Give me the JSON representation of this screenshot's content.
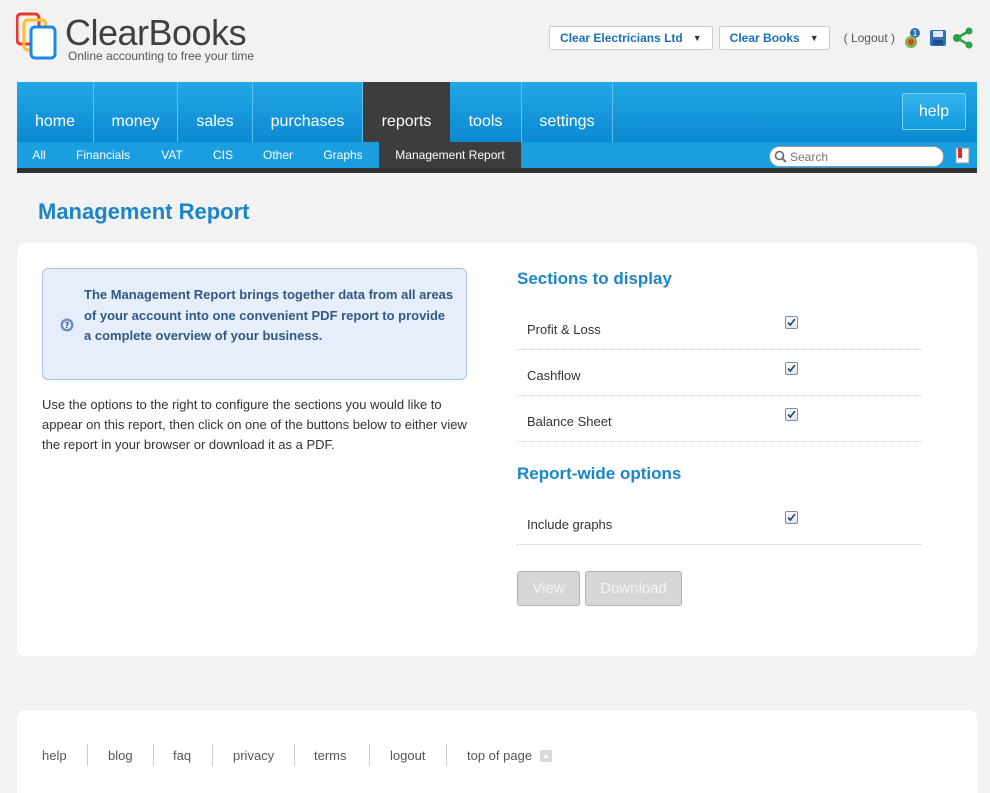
{
  "brand": {
    "name": "ClearBooks",
    "tagline": "Online accounting to free your time"
  },
  "header": {
    "company_selector": "Clear Electricians Ltd",
    "product_selector": "Clear Books",
    "logout_label": "( Logout )",
    "icons": [
      "user-status-icon",
      "save-icon",
      "share-icon"
    ]
  },
  "nav": {
    "items": [
      {
        "label": "home"
      },
      {
        "label": "money"
      },
      {
        "label": "sales"
      },
      {
        "label": "purchases"
      },
      {
        "label": "reports"
      },
      {
        "label": "tools"
      },
      {
        "label": "settings"
      }
    ],
    "active": "reports",
    "help_label": "help"
  },
  "subnav": {
    "items": [
      {
        "label": "All"
      },
      {
        "label": "Financials"
      },
      {
        "label": "VAT"
      },
      {
        "label": "CIS"
      },
      {
        "label": "Other"
      },
      {
        "label": "Graphs"
      },
      {
        "label": "Management Report"
      }
    ],
    "active": "Management Report",
    "search_placeholder": "Search"
  },
  "page": {
    "title": "Management Report",
    "info_text": "The Management Report brings together data from all areas of your account into one convenient PDF report to provide a complete overview of your business.",
    "description": "Use the options to the right to configure the sections you would like to appear on this report, then click on one of the buttons below to either view the report in your browser or download it as a PDF."
  },
  "sections": {
    "title": "Sections to display",
    "options": [
      {
        "label": "Profit & Loss",
        "checked": true
      },
      {
        "label": "Cashflow",
        "checked": true
      },
      {
        "label": "Balance Sheet",
        "checked": true
      }
    ]
  },
  "report_options": {
    "title": "Report-wide options",
    "options": [
      {
        "label": "Include graphs",
        "checked": true
      }
    ]
  },
  "buttons": {
    "view": "View",
    "download": "Download"
  },
  "footer": {
    "links": [
      {
        "label": "help"
      },
      {
        "label": "blog"
      },
      {
        "label": "faq"
      },
      {
        "label": "privacy"
      },
      {
        "label": "terms"
      },
      {
        "label": "logout"
      },
      {
        "label": "top of page"
      }
    ]
  },
  "colors": {
    "accent": "#1a86c9",
    "nav_blue": "#1b9ee0",
    "nav_active": "#3d3d3d",
    "info_bg": "#e6eefb"
  }
}
